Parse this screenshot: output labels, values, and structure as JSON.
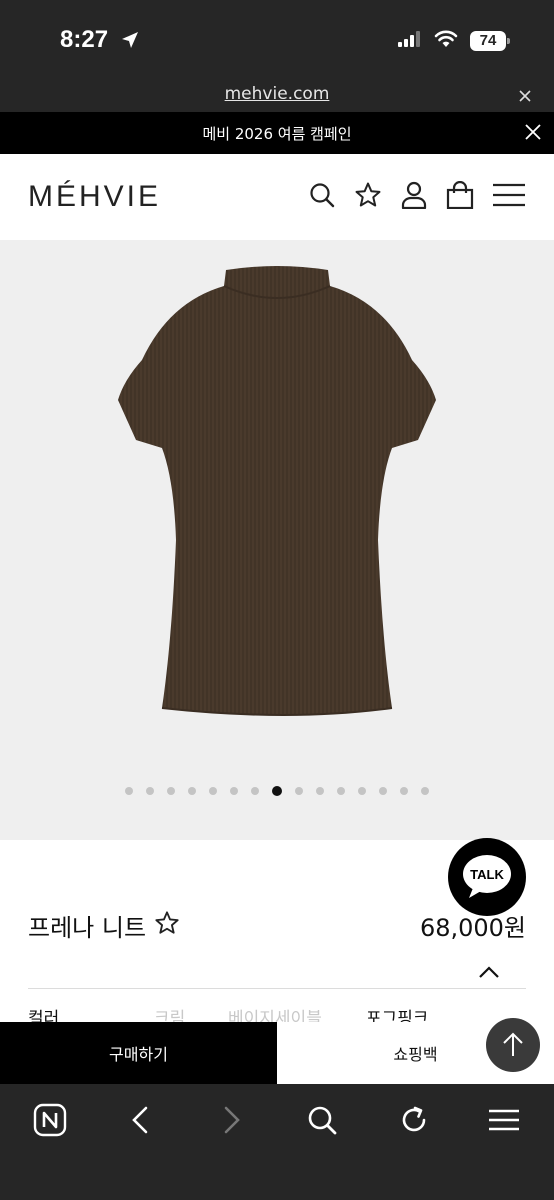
{
  "status_bar": {
    "time": "8:27",
    "battery": "74"
  },
  "browser": {
    "url": "mehvie.com"
  },
  "promo": {
    "text": "메비 2026 여름 캠페인"
  },
  "header": {
    "logo": "MÉHVIE"
  },
  "gallery": {
    "slide_count": 15,
    "active_index": 7,
    "garment_color": "#4a3a2c"
  },
  "chat": {
    "label": "TALK"
  },
  "product": {
    "name": "프레나 니트",
    "price": "68,000원",
    "color_label": "컬러",
    "color_options": [
      "크림",
      "베이지세이블",
      "포그핑크"
    ],
    "selected_color": "포그핑크"
  },
  "actions": {
    "buy": "구매하기",
    "bag": "쇼핑백"
  },
  "colors": {
    "dark_bar": "#262626",
    "promo_bg": "#000000",
    "gallery_bg": "#efefef"
  }
}
